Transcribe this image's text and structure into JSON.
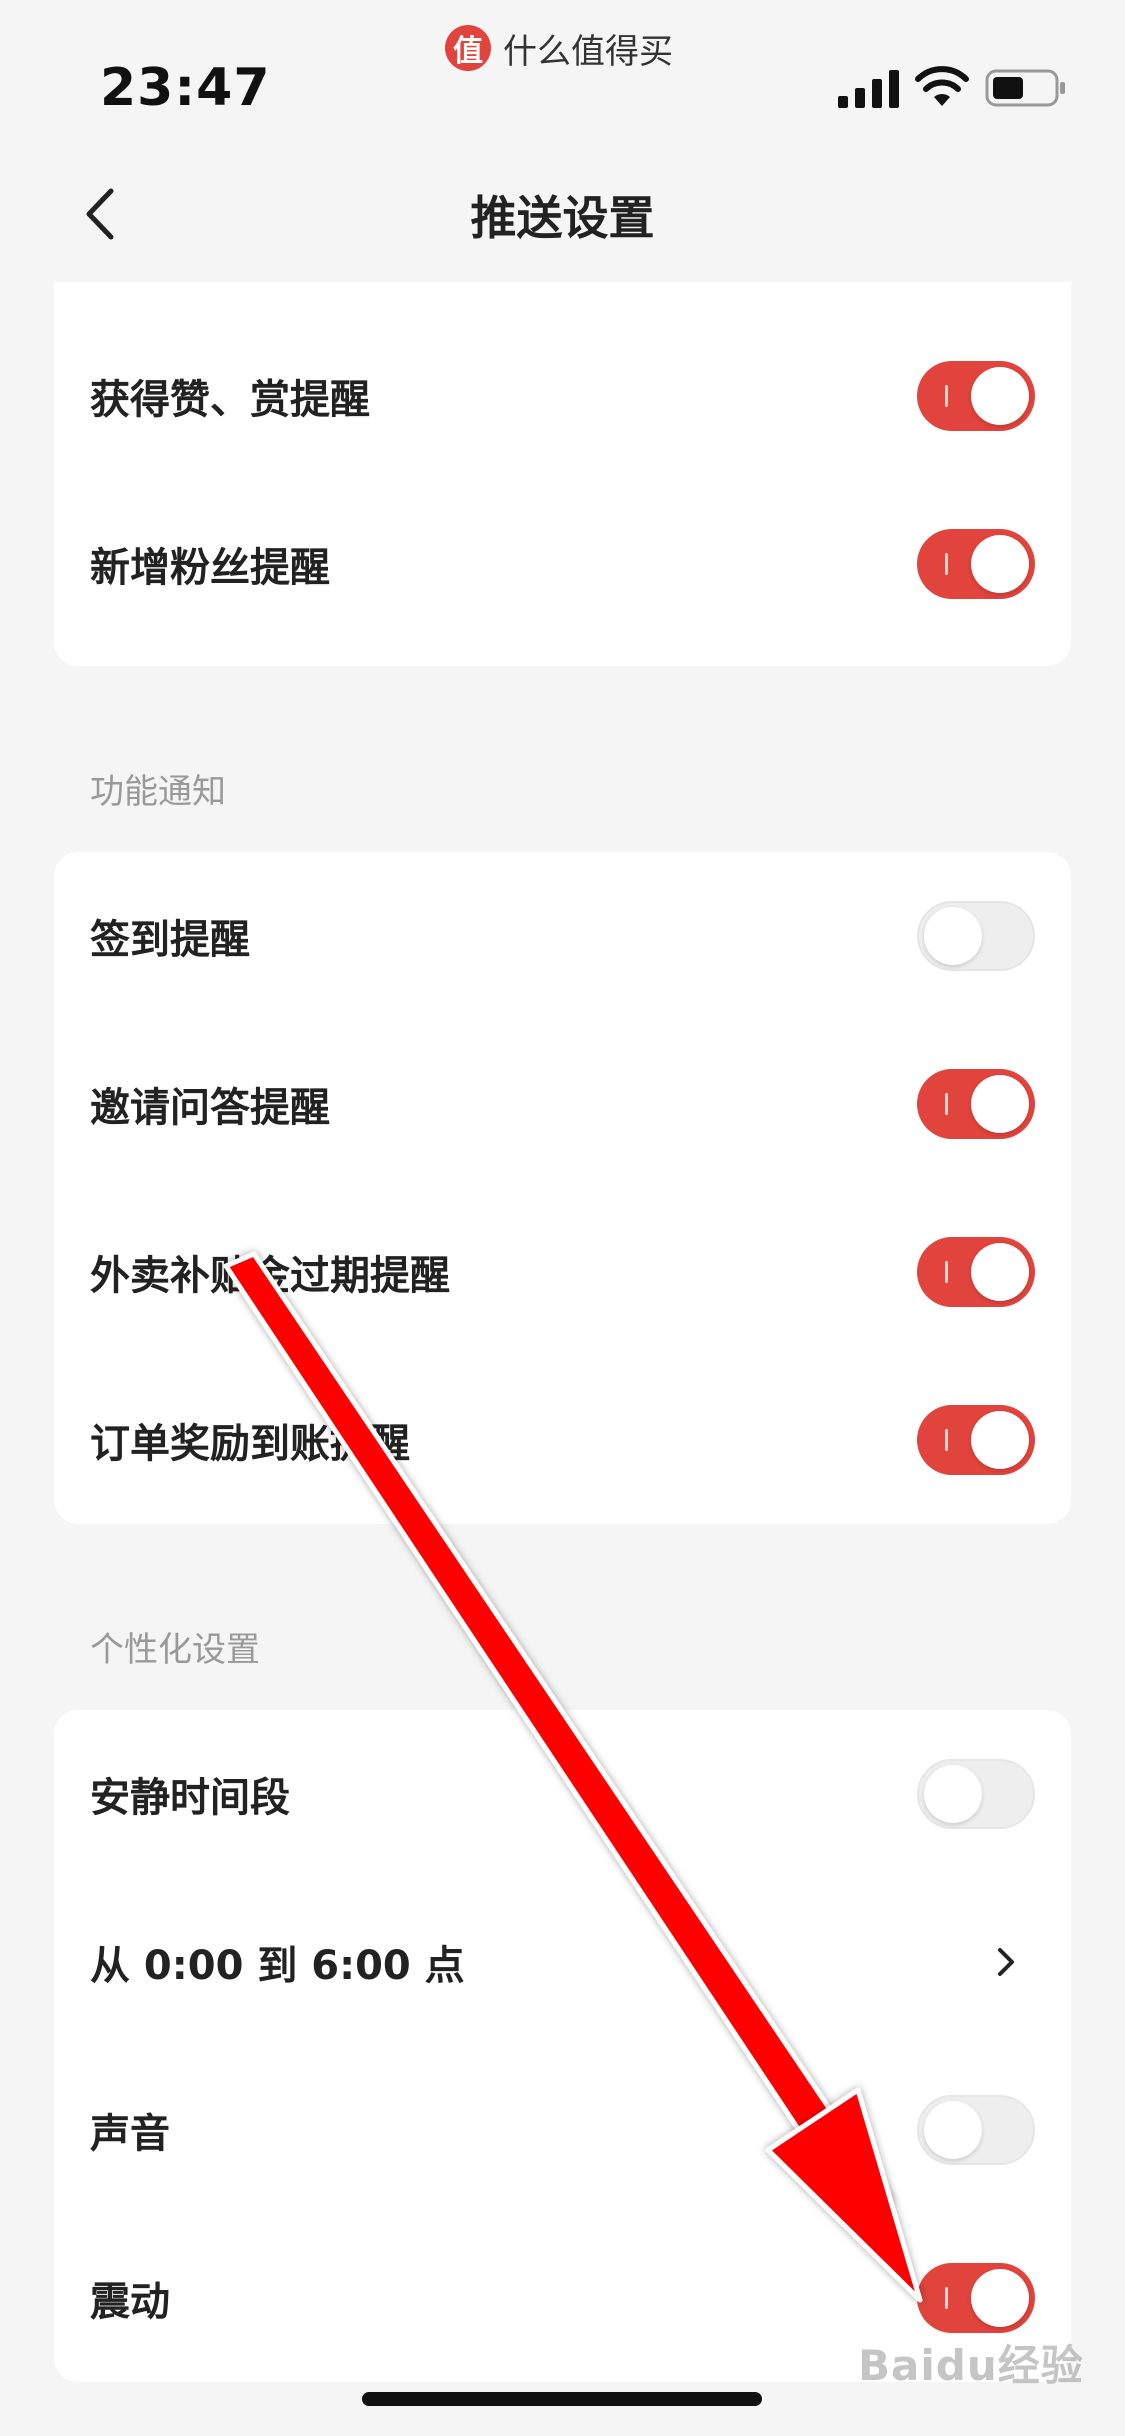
{
  "status_bar": {
    "time": "23:47",
    "app_logo_glyph": "值",
    "app_name": "什么值得买",
    "icons": [
      "signal-icon",
      "wifi-icon",
      "battery-icon"
    ]
  },
  "nav": {
    "title": "推送设置",
    "back_icon": "chevron-left-icon"
  },
  "interaction_section": {
    "items": [
      {
        "label": "获得赞、赏提醒",
        "enabled": true
      },
      {
        "label": "新增粉丝提醒",
        "enabled": true
      }
    ]
  },
  "function_section": {
    "title": "功能通知",
    "items": [
      {
        "label": "签到提醒",
        "enabled": false
      },
      {
        "label": "邀请问答提醒",
        "enabled": true
      },
      {
        "label": "外卖补贴金过期提醒",
        "enabled": true
      },
      {
        "label": "订单奖励到账提醒",
        "enabled": true
      }
    ]
  },
  "personal_section": {
    "title": "个性化设置",
    "quiet_label": "安静时间段",
    "quiet_enabled": false,
    "quiet_range": "从 0:00 到 6:00 点",
    "sound_label": "声音",
    "sound_enabled": false,
    "vibrate_label": "震动",
    "vibrate_enabled": true
  },
  "watermark": "Baidu经验",
  "colors": {
    "accent": "#e0443c",
    "annotation_arrow": "#ff0000",
    "background": "#f5f5f5"
  }
}
